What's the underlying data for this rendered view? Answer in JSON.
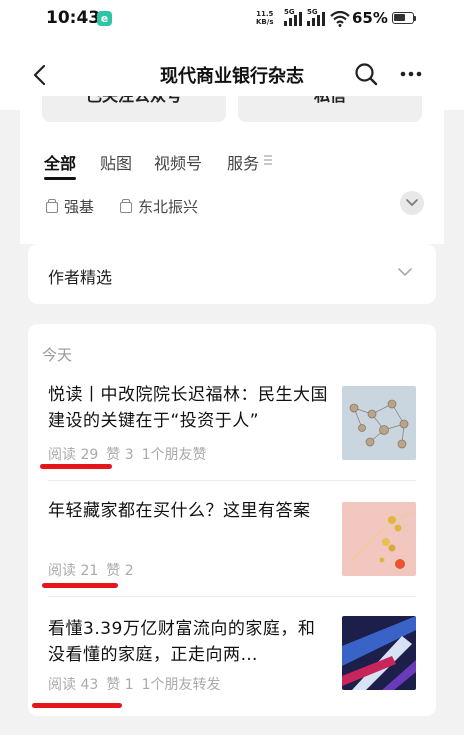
{
  "status": {
    "time": "10:43",
    "net_speed_value": "11.5",
    "net_speed_unit": "KB/s",
    "signal1": "5G",
    "signal2": "5G",
    "battery": "65%",
    "battery_level": 0.65
  },
  "nav": {
    "title": "现代商业银行杂志"
  },
  "profile": {
    "follow_label": "已关注公众号",
    "message_label": "私信",
    "tabs": [
      "全部",
      "贴图",
      "视频号",
      "服务"
    ],
    "topics": [
      "强基",
      "东北振兴"
    ]
  },
  "author_section": {
    "label": "作者精选"
  },
  "feed": {
    "date_label": "今天",
    "articles": [
      {
        "title": "悦读丨中改院院长迟福林：民生大国建设的关键在于“投资于人”",
        "reads": "阅读 29",
        "likes": "赞 3",
        "social": "1个朋友赞"
      },
      {
        "title": "年轻藏家都在买什么？这里有答案",
        "reads": "阅读 21",
        "likes": "赞 2",
        "social": ""
      },
      {
        "title": "看懂3.39万亿财富流向的家庭，和没看懂的家庭，正走向两…",
        "reads": "阅读 43",
        "likes": "赞 1",
        "social": "1个朋友转发"
      }
    ]
  },
  "colors": {
    "accent_mark": "#e5151c",
    "app_badge": "#2ec4a8"
  }
}
